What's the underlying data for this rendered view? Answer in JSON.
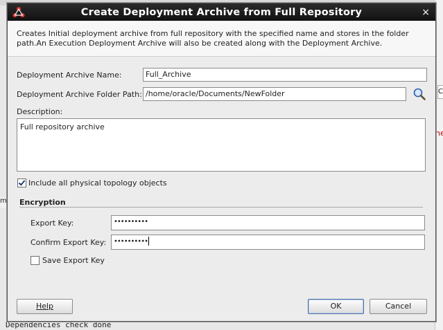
{
  "dialog": {
    "title": "Create Deployment Archive from Full Repository",
    "close_glyph": "×",
    "description": "Creates Initial deployment archive from full repository with the specified name and stores in the folder path.An Execution Deployment Archive will also be created along with the Deployment Archive."
  },
  "form": {
    "name_label": "Deployment Archive Name:",
    "name_value": "Full_Archive",
    "folder_label": "Deployment Archive Folder Path:",
    "folder_value": "/home/oracle/Documents/NewFolder",
    "description_label": "Description:",
    "description_value": "Full repository archive",
    "include_label": "Include all physical topology objects",
    "include_checked": true
  },
  "encryption": {
    "title": "Encryption",
    "export_key_label": "Export Key:",
    "export_key_value": "••••••••••",
    "confirm_key_label": "Confirm Export Key:",
    "confirm_key_value": "••••••••••",
    "save_key_label": "Save Export Key",
    "save_key_checked": false
  },
  "buttons": {
    "help": "Help",
    "ok": "OK",
    "cancel": "Cancel"
  },
  "background": {
    "bottom_text": "Dependencies check done",
    "left_fragment": "me",
    "right_button_fragment": "C",
    "right_red_fragment": "ne"
  },
  "icons": {
    "title_icon": "odi-app-icon",
    "search": "search-icon"
  },
  "colors": {
    "titlebar": "#111111",
    "default_button_border": "#4b6ea8",
    "check_mark": "#1c3e7a"
  }
}
